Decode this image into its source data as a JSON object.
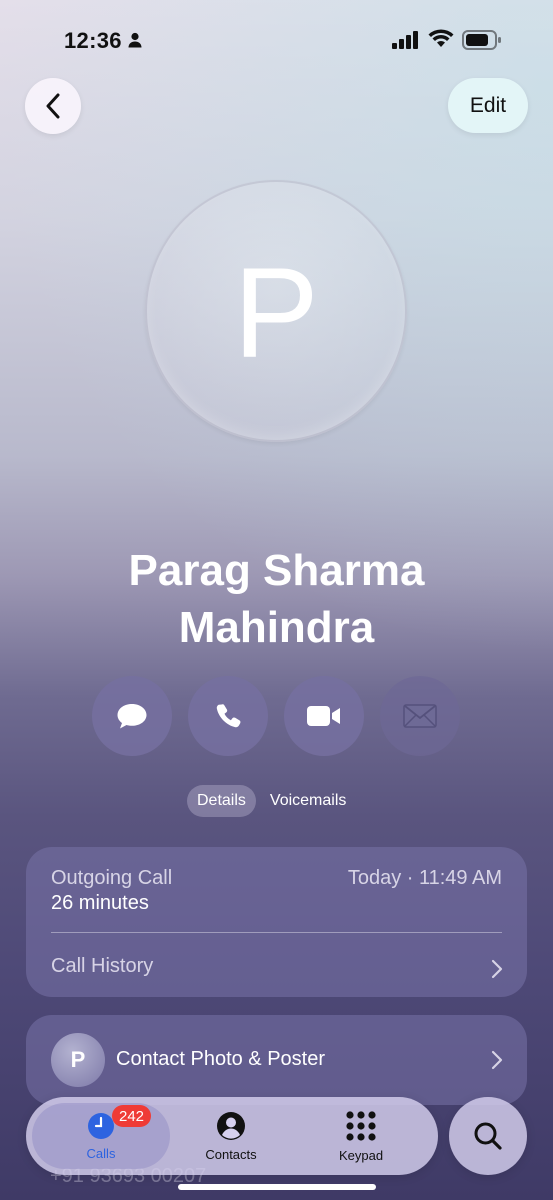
{
  "status_bar": {
    "time": "12:36"
  },
  "header": {
    "edit_label": "Edit"
  },
  "contact": {
    "initial": "P",
    "name_line1": "Parag Sharma",
    "name_line2": "Mahindra"
  },
  "actions": [
    "message",
    "call",
    "video",
    "mail"
  ],
  "segments": {
    "details": "Details",
    "voicemails": "Voicemails",
    "selected": "Details"
  },
  "recent_call": {
    "type": "Outgoing Call",
    "duration": "26 minutes",
    "when": "Today · 11:49 AM",
    "history_label": "Call History"
  },
  "photo_card": {
    "initial": "P",
    "label": "Contact Photo & Poster"
  },
  "peek_text": "+91 93693 00207",
  "tabbar": {
    "calls": "Calls",
    "calls_badge": "242",
    "contacts": "Contacts",
    "keypad": "Keypad",
    "selected": "Calls"
  },
  "colors": {
    "accent": "#2d63e0",
    "badge": "#ef3b36"
  }
}
